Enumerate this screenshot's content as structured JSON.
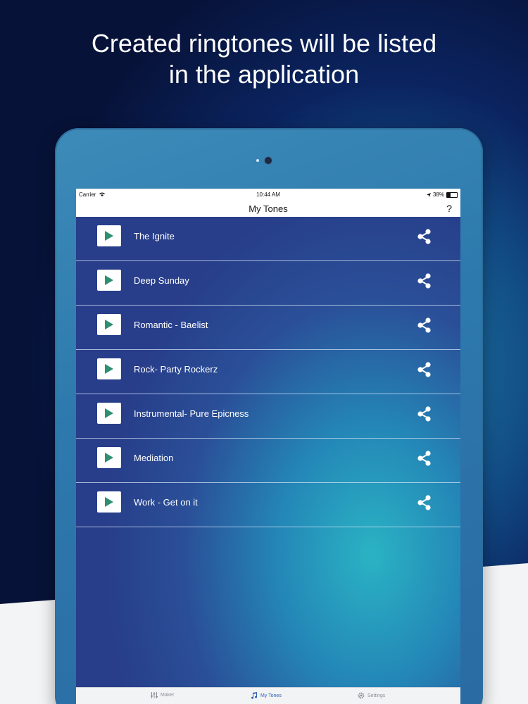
{
  "headline": {
    "line1": "Created ringtones will be listed",
    "line2": "in the application"
  },
  "status_bar": {
    "carrier": "Carrier",
    "time": "10:44 AM",
    "battery": "38%",
    "battery_level": 0.38
  },
  "nav_bar": {
    "title": "My Tones",
    "help_label": "?"
  },
  "tones": [
    {
      "name": "The Ignite"
    },
    {
      "name": "Deep Sunday"
    },
    {
      "name": "Romantic - Baelist"
    },
    {
      "name": "Rock- Party Rockerz"
    },
    {
      "name": "Instrumental- Pure Epicness"
    },
    {
      "name": "Mediation"
    },
    {
      "name": "Work - Get on it"
    }
  ],
  "icons": {
    "play": "play-icon",
    "share": "share-icon",
    "wifi": "wifi-icon",
    "location": "location-arrow-icon",
    "maker": "sliders-icon",
    "my_tones": "music-note-icon",
    "settings": "gear-icon"
  },
  "tab_bar": {
    "tabs": [
      {
        "label": "Maker"
      },
      {
        "label": "My Tones"
      },
      {
        "label": "Settings"
      }
    ],
    "active_color": "#2f5fb0",
    "inactive_color": "#8a8f98"
  },
  "colors": {
    "play_triangle": "#2f8f72",
    "text_on_list": "#ffffff"
  }
}
